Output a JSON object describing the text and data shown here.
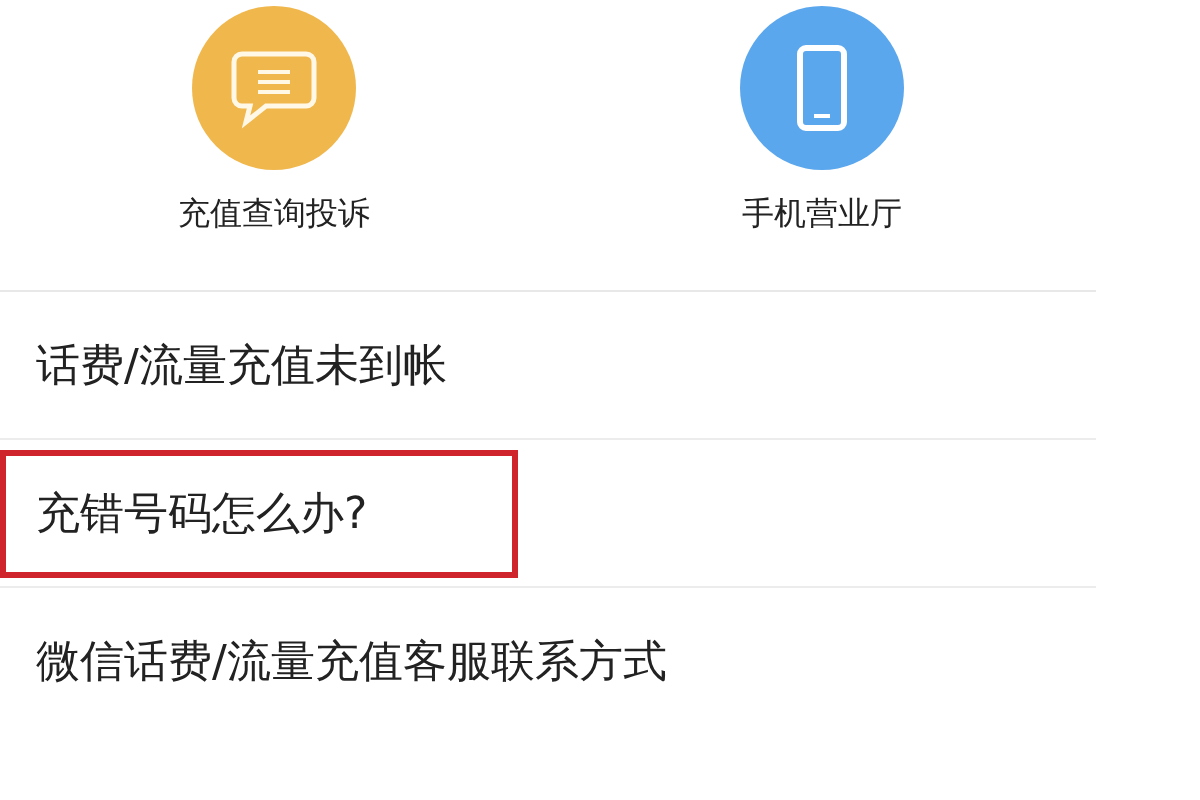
{
  "shortcuts": [
    {
      "label": "充值查询投诉",
      "kind": "chat",
      "color": "#f0b74d"
    },
    {
      "label": "手机营业厅",
      "kind": "phone",
      "color": "#5aa7ee"
    }
  ],
  "items": [
    {
      "label": "话费/流量充值未到帐",
      "highlighted": false
    },
    {
      "label": "充错号码怎么办?",
      "highlighted": true
    },
    {
      "label": "微信话费/流量充值客服联系方式",
      "highlighted": false
    }
  ]
}
